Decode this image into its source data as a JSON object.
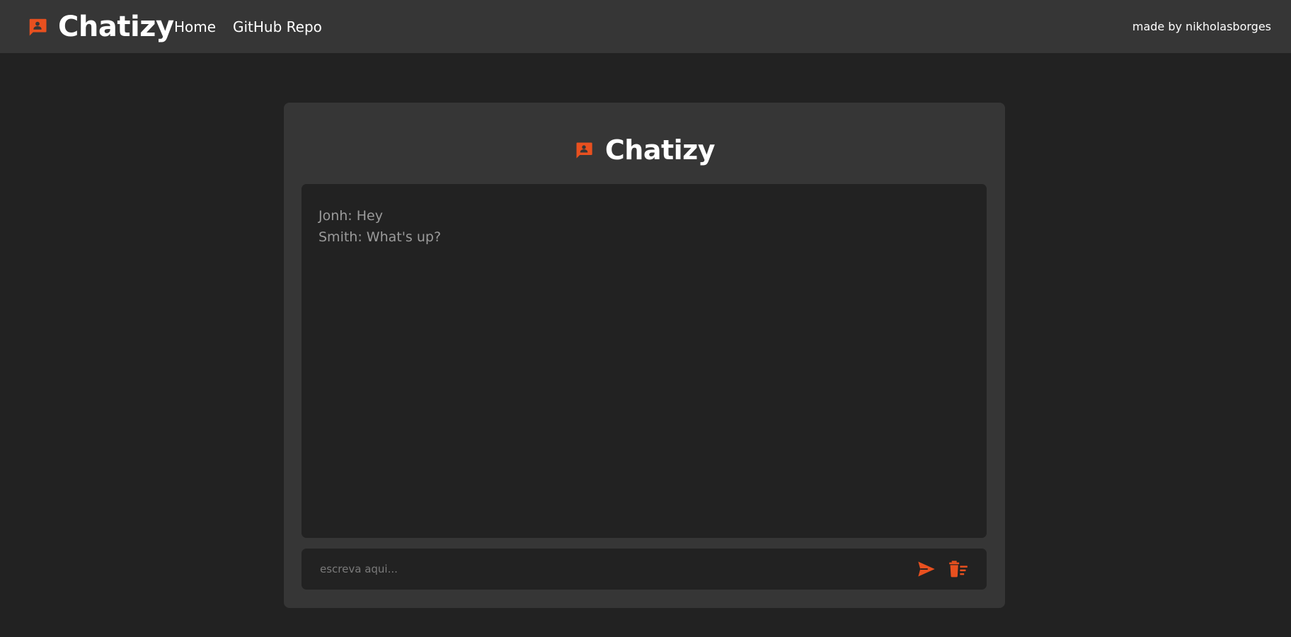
{
  "colors": {
    "accent": "#e8501f",
    "page_background": "#222222",
    "surface": "#363636",
    "muted_text": "#9b9b9b"
  },
  "navbar": {
    "brand": "Chatizy",
    "brand_icon": "chat-icon",
    "links": [
      {
        "label": "Home"
      },
      {
        "label": "GitHub Repo"
      }
    ],
    "credit": "made by nikholasborges"
  },
  "chat": {
    "title": "Chatizy",
    "title_icon": "chat-icon",
    "messages": [
      {
        "text": "Jonh: Hey"
      },
      {
        "text": "Smith: What's up?"
      }
    ],
    "input": {
      "placeholder": "escreva aqui...",
      "value": ""
    },
    "send_icon": "send-icon",
    "clear_icon": "delete-sweep-icon"
  }
}
